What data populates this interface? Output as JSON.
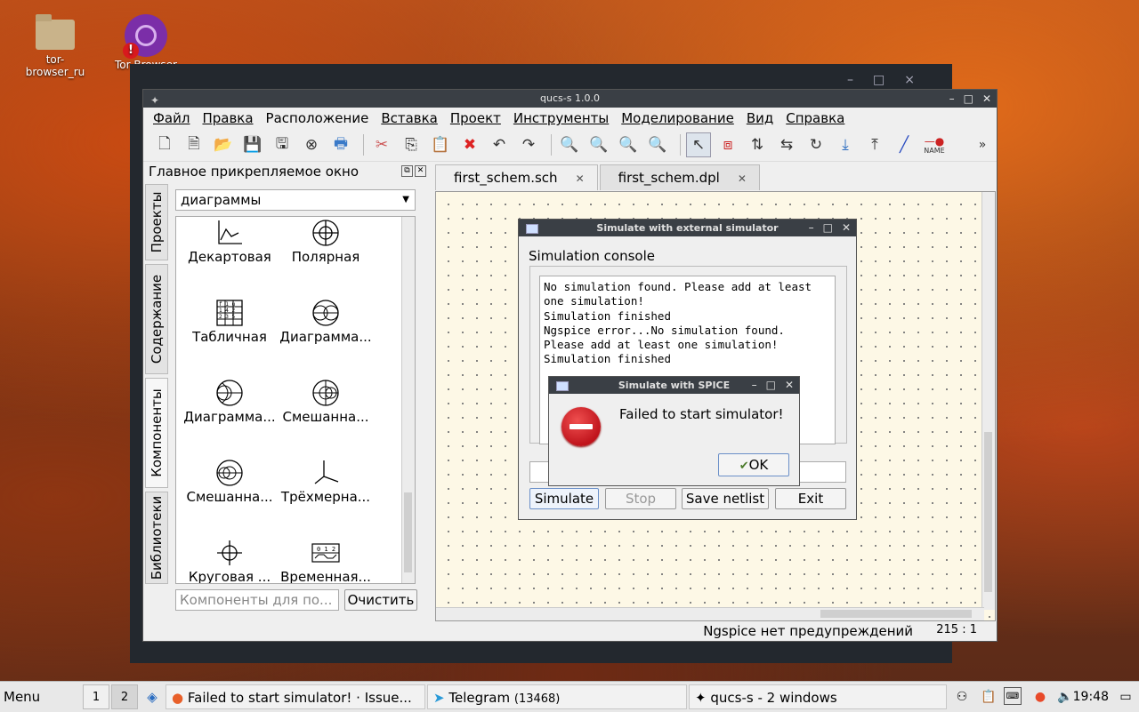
{
  "desktop": {
    "icons": [
      {
        "label": "tor-\nbrowser_ru"
      },
      {
        "label": "Tor Browser"
      }
    ]
  },
  "main_window": {
    "title": "qucs-s 1.0.0",
    "menu": [
      "Файл",
      "Правка",
      "Расположение",
      "Вставка",
      "Проект",
      "Инструменты",
      "Моделирование",
      "Вид",
      "Справка"
    ],
    "toolbar": {
      "name_label": "NAME",
      "more": "»"
    },
    "dock": {
      "title": "Главное прикрепляемое окно",
      "vtabs": [
        "Проекты",
        "Содержание",
        "Компоненты",
        "Библиотеки"
      ],
      "combo_value": "диаграммы",
      "components": [
        "Декартовая",
        "Полярная",
        "Табличная",
        "Диаграмма...",
        "Диаграмма...",
        "Смешанна...",
        "Смешанна...",
        "Трёхмерна...",
        "Круговая ...",
        "Временная..."
      ],
      "search_placeholder": "Компоненты для по...",
      "clear_button": "Очистить"
    },
    "tabs": [
      "first_schem.sch",
      "first_schem.dpl"
    ],
    "status": {
      "message": "Ngspice нет предупреждений",
      "position": "215 : 1"
    }
  },
  "sim_dialog": {
    "title": "Simulate with external simulator",
    "console_label": "Simulation console",
    "console_text": "No simulation found. Please add at least one simulation!\nSimulation finished\nNgspice error...No simulation found. Please add at least one simulation!\nSimulation finished",
    "buttons": {
      "simulate": "Simulate",
      "stop": "Stop",
      "save_netlist": "Save netlist",
      "exit": "Exit"
    }
  },
  "error_dialog": {
    "title": "Simulate with SPICE",
    "message": "Failed to start simulator!",
    "ok": "OK"
  },
  "taskbar": {
    "menu": "Menu",
    "workspaces": [
      "1",
      "2"
    ],
    "active_workspace": "2",
    "tasks": [
      {
        "label": "Failed to start simulator! · Issue..."
      },
      {
        "label": "Telegram",
        "badge": "(13468)"
      },
      {
        "label": "qucs-s - 2 windows"
      }
    ],
    "clock": "19:48"
  }
}
